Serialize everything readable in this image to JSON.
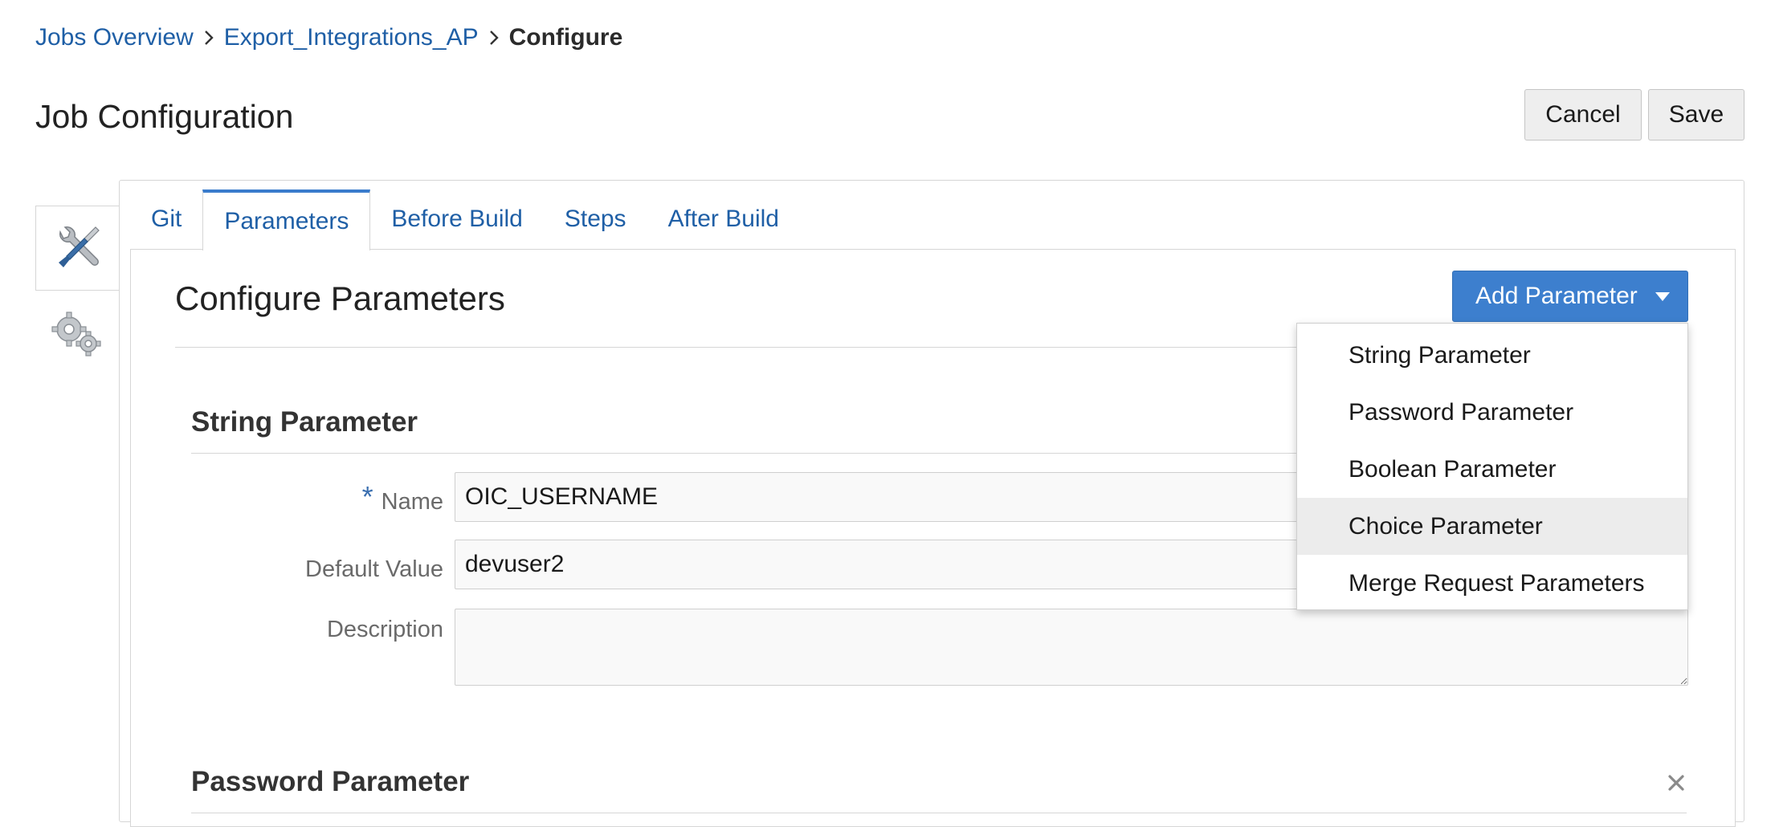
{
  "breadcrumb": {
    "items": [
      "Jobs Overview",
      "Export_Integrations_AP"
    ],
    "current": "Configure"
  },
  "page": {
    "title": "Job Configuration",
    "cancel_label": "Cancel",
    "save_label": "Save"
  },
  "rail": {
    "active_icon": "tools-icon",
    "secondary_icon": "gears-icon"
  },
  "tabs": [
    {
      "label": "Git",
      "active": false
    },
    {
      "label": "Parameters",
      "active": true
    },
    {
      "label": "Before Build",
      "active": false
    },
    {
      "label": "Steps",
      "active": false
    },
    {
      "label": "After Build",
      "active": false
    }
  ],
  "section": {
    "title": "Configure Parameters",
    "add_button_label": "Add Parameter"
  },
  "string_parameter": {
    "title": "String Parameter",
    "name_label": "Name",
    "name_value": "OIC_USERNAME",
    "default_label": "Default Value",
    "default_value": "devuser2",
    "description_label": "Description",
    "description_value": ""
  },
  "password_parameter": {
    "title": "Password Parameter"
  },
  "dropdown": {
    "items": [
      "String Parameter",
      "Password Parameter",
      "Boolean Parameter",
      "Choice Parameter",
      "Merge Request Parameters"
    ],
    "highlighted": "Choice Parameter"
  },
  "colors": {
    "link": "#1f5fa6",
    "primary_button": "#3d7fce",
    "tab_accent": "#3a7ccc",
    "required_star": "#3a6fb0"
  }
}
